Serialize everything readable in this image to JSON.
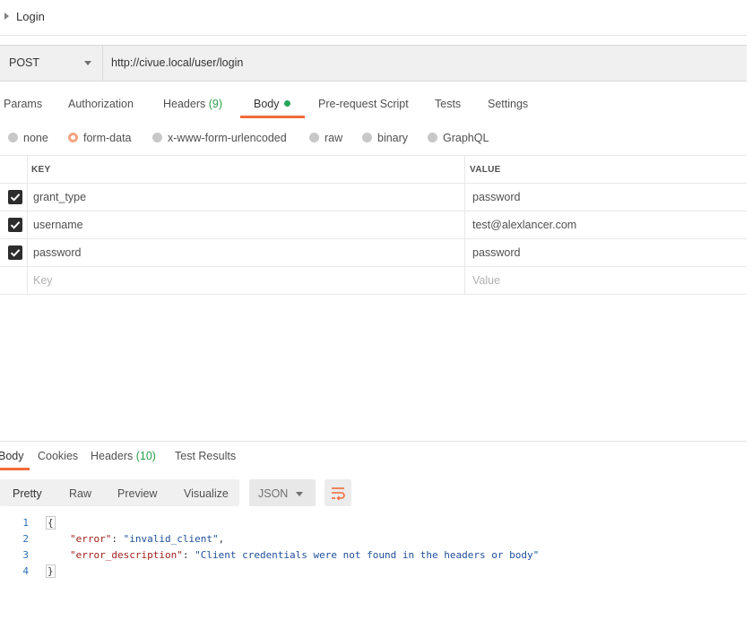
{
  "request": {
    "title": "Login",
    "method": "POST",
    "url": "http://civue.local/user/login"
  },
  "request_tabs": [
    {
      "label": "Params"
    },
    {
      "label": "Authorization"
    },
    {
      "label": "Headers",
      "count": "(9)"
    },
    {
      "label": "Body",
      "active": true
    },
    {
      "label": "Pre-request Script"
    },
    {
      "label": "Tests"
    },
    {
      "label": "Settings"
    }
  ],
  "body_types": [
    {
      "label": "none",
      "selected": false
    },
    {
      "label": "form-data",
      "selected": true
    },
    {
      "label": "x-www-form-urlencoded",
      "selected": false
    },
    {
      "label": "raw",
      "selected": false
    },
    {
      "label": "binary",
      "selected": false
    },
    {
      "label": "GraphQL",
      "selected": false
    }
  ],
  "form_table": {
    "headers": {
      "key": "KEY",
      "value": "VALUE"
    },
    "rows": [
      {
        "checked": true,
        "key": "grant_type",
        "value": "password"
      },
      {
        "checked": true,
        "key": "username",
        "value": "test@alexlancer.com"
      },
      {
        "checked": true,
        "key": "password",
        "value": "password"
      }
    ],
    "placeholder": {
      "key": "Key",
      "value": "Value"
    }
  },
  "response_tabs": [
    {
      "label": "Body",
      "active": true
    },
    {
      "label": "Cookies"
    },
    {
      "label": "Headers",
      "count": "(10)"
    },
    {
      "label": "Test Results"
    }
  ],
  "view_modes": [
    {
      "label": "Pretty",
      "active": true
    },
    {
      "label": "Raw"
    },
    {
      "label": "Preview"
    },
    {
      "label": "Visualize"
    }
  ],
  "format_select": "JSON",
  "wrap_icon": "wrap-lines-icon",
  "response_body": {
    "line_numbers": [
      "1",
      "2",
      "3",
      "4"
    ],
    "open_brace": "{",
    "close_brace": "}",
    "entries": [
      {
        "key": "\"error\"",
        "sep": ": ",
        "value": "\"invalid_client\"",
        "trail": ","
      },
      {
        "key": "\"error_description\"",
        "sep": ": ",
        "value": "\"Client credentials were not found in the headers or body\"",
        "trail": ""
      }
    ]
  },
  "colors": {
    "accent": "#f26b3a",
    "status_green": "#26a65b",
    "json_key": "#a0221e",
    "json_string": "#1f4f9a"
  }
}
